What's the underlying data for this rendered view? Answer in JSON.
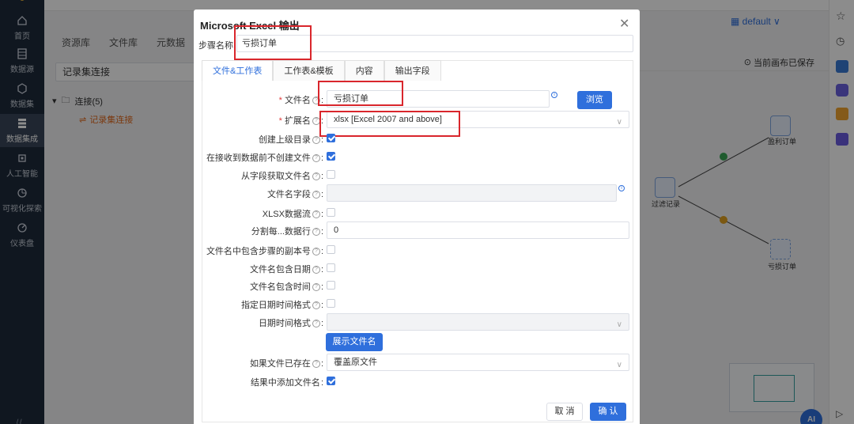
{
  "nav": {
    "items": [
      {
        "label": "首页",
        "icon": "home-icon"
      },
      {
        "label": "数据源",
        "icon": "database-icon"
      },
      {
        "label": "数据集",
        "icon": "cube-icon"
      },
      {
        "label": "数据集成",
        "icon": "integration-icon"
      },
      {
        "label": "人工智能",
        "icon": "ai-icon"
      },
      {
        "label": "可视化探索",
        "icon": "chart-pie-icon"
      },
      {
        "label": "仪表盘",
        "icon": "dashboard-icon"
      }
    ],
    "active_index": 3
  },
  "main": {
    "tabs": [
      "资源库",
      "文件库",
      "元数据"
    ],
    "crumb": "记录集连接",
    "tree": {
      "root": "连接(5)",
      "child": "记录集连接"
    },
    "canvas_status": "当前画布已保存",
    "workspace": "default",
    "nodes": [
      "盈利订单",
      "过滤记录",
      "亏损订单"
    ]
  },
  "dialog": {
    "title": "Microsoft Excel 输出",
    "step_name_label": "步骤名称:",
    "step_name_value": "亏损订单",
    "tabs": [
      "文件&工作表",
      "工作表&模板",
      "内容",
      "输出字段"
    ],
    "active_tab": 0,
    "fields": {
      "filename_label": "文件名",
      "filename_value": "亏损订单",
      "browse_button": "浏览",
      "ext_label": "扩展名",
      "ext_value": "xlsx [Excel 2007 and above]",
      "create_parent_label": "创建上级目录",
      "no_create_label": "在接收到数据前不创建文件",
      "from_field_label": "从字段获取文件名",
      "filename_field_label": "文件名字段",
      "xlsx_stream_label": "XLSX数据流",
      "split_label": "分割每...数据行",
      "split_value": "0",
      "include_step_label": "文件名中包含步骤的副本号",
      "include_date_label": "文件名包含日期",
      "include_time_label": "文件名包含时间",
      "specify_fmt_label": "指定日期时间格式",
      "datetime_fmt_label": "日期时间格式",
      "show_filename_button": "展示文件名",
      "if_exists_label": "如果文件已存在",
      "if_exists_value": "覆盖原文件",
      "add_to_result_label": "结果中添加文件名"
    },
    "checks": {
      "create_parent": true,
      "no_create": true,
      "from_field": false,
      "xlsx_stream": false,
      "include_step": false,
      "include_date": false,
      "include_time": false,
      "specify_fmt": false,
      "add_to_result": true
    },
    "cancel_button": "取 消",
    "ok_button": "确 认"
  },
  "colors": {
    "accent": "#2f6fdc",
    "highlight_box": "#d9262c",
    "nav_bg": "#1e2a3b"
  },
  "ai_badge": "AI"
}
